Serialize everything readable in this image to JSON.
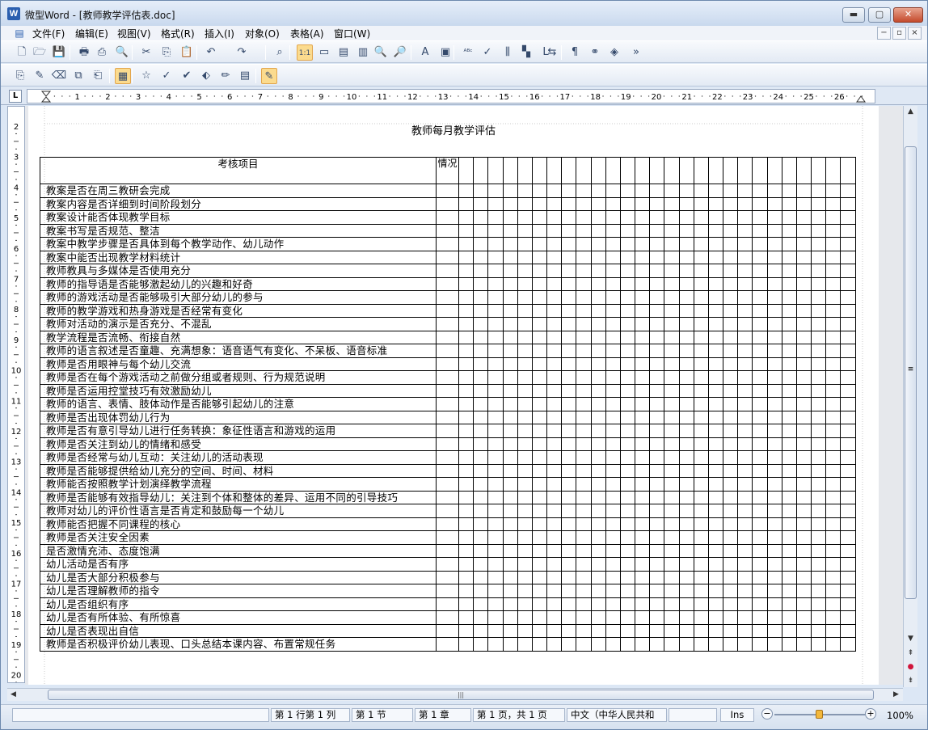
{
  "window": {
    "app_icon": "W",
    "title": "微型Word - [教师教学评估表.doc]",
    "minimize": "▬",
    "maximize": "▢",
    "close": "✕"
  },
  "menu": {
    "items": [
      "文件(F)",
      "编辑(E)",
      "视图(V)",
      "格式(R)",
      "插入(I)",
      "对象(O)",
      "表格(A)",
      "窗口(W)"
    ],
    "mdi_minimize": "−",
    "mdi_restore": "▫",
    "mdi_close": "×"
  },
  "toolbar1": {
    "icons": [
      "new-document-icon",
      "open-folder-icon",
      "save-icon",
      "print-icon",
      "pdf-export-icon",
      "print-preview-icon",
      "cut-icon",
      "copy-icon",
      "paste-icon",
      "undo-icon",
      "redo-icon",
      "find-icon",
      "actual-size-icon",
      "page-width-icon",
      "single-page-icon",
      "two-pages-icon",
      "zoom-in-icon",
      "zoom-out-icon",
      "font-color-icon",
      "text-box-icon",
      "spell-check-icon",
      "auto-correct-icon",
      "columns-icon",
      "shadow-icon",
      "border-icon",
      "merge-icon",
      "paragraph-marks-icon",
      "link-icon",
      "object-icon"
    ],
    "glyphs": [
      "🗋",
      "🗁",
      "💾",
      "🖶",
      "⎙",
      "🔍",
      "✂",
      "⎘",
      "📋",
      "↶",
      "↷",
      "⌕",
      "1:1",
      "▭",
      "▤",
      "▥",
      "🔍",
      "🔎",
      "A",
      "▣",
      "ᴬᴮᶜ",
      "✓",
      "⫼",
      "▚",
      "L",
      "⇆",
      "¶",
      "⚭",
      "◈"
    ],
    "more": "»"
  },
  "toolbar2": {
    "icons": [
      "insert-field-icon",
      "edit-field-icon",
      "delete-field-icon",
      "copy-field-icon",
      "paste-field-icon",
      "form-icon",
      "star-icon",
      "check-icon",
      "highlight-icon",
      "tag-icon",
      "pencil-icon",
      "notes-icon",
      "review-icon"
    ],
    "glyphs": [
      "⎘",
      "✎",
      "⌫",
      "⧉",
      "⎗",
      "▦",
      "☆",
      "✓",
      "✔",
      "⬖",
      "✏",
      "▤",
      "✎"
    ]
  },
  "ruler": {
    "tab_label": "L",
    "h_ticks": [
      "1",
      "2",
      "3",
      "4",
      "5",
      "6",
      "7",
      "8",
      "9",
      "10",
      "11",
      "12",
      "13",
      "14",
      "15",
      "16",
      "17",
      "18",
      "19",
      "20",
      "21",
      "22",
      "23",
      "24",
      "25",
      "26"
    ],
    "v_ticks": [
      "2",
      "3",
      "4",
      "5",
      "6",
      "7",
      "8",
      "9",
      "10",
      "11",
      "12",
      "13",
      "14",
      "15",
      "16",
      "17",
      "18",
      "19",
      "20"
    ]
  },
  "document": {
    "title": "教师每月教学评估",
    "header_item": "考核项目",
    "header_status": "情况",
    "rows": [
      "教案是否在周三教研会完成",
      "教案内容是否详细到时间阶段划分",
      "教案设计能否体现教学目标",
      "教案书写是否规范、整洁",
      "教案中教学步骤是否具体到每个教学动作、幼儿动作",
      "教案中能否出现教学材料统计",
      "教师教具与多媒体是否使用充分",
      "教师的指导语是否能够激起幼儿的兴趣和好奇",
      "教师的游戏活动是否能够吸引大部分幼儿的参与",
      "教师的教学游戏和热身游戏是否经常有变化",
      "教师对活动的演示是否充分、不混乱",
      "教学流程是否流畅、衔接自然",
      "教师的语言叙述是否童趣、充满想象：语音语气有变化、不呆板、语音标准",
      "教师是否用眼神与每个幼儿交流",
      "教师是否在每个游戏活动之前做分组或者规则、行为规范说明",
      "教师是否运用控堂技巧有效激励幼儿",
      "教师的语言、表情、肢体动作是否能够引起幼儿的注意",
      "教师是否出现体罚幼儿行为",
      "教师是否有意引导幼儿进行任务转换：象征性语言和游戏的运用",
      "教师是否关注到幼儿的情绪和感受",
      "教师是否经常与幼儿互动：关注幼儿的活动表现",
      "教师是否能够提供给幼儿充分的空间、时间、材料",
      "教师能否按照教学计划演绎教学流程",
      "教师是否能够有效指导幼儿：关注到个体和整体的差异、运用不同的引导技巧",
      "教师对幼儿的评价性语言是否肯定和鼓励每一个幼儿",
      "教师能否把握不同课程的核心",
      "教师是否关注安全因素",
      "是否激情充沛、态度饱满",
      "幼儿活动是否有序",
      "幼儿是否大部分积极参与",
      "幼儿是否理解教师的指令",
      "幼儿是否组织有序",
      "幼儿是否有所体验、有所惊喜",
      "幼儿是否表现出自信",
      "教师是否积极评价幼儿表现、口头总结本课内容、布置常规任务"
    ]
  },
  "scrollbars": {
    "up": "▲",
    "down": "▼",
    "left": "◀",
    "right": "▶",
    "prev_page": "⇞",
    "select_browse": "●",
    "next_page": "⇟",
    "h_grip": "|||",
    "v_grip": "≡"
  },
  "status": {
    "position": "第 1 行第 1 列",
    "section": "第 1 节",
    "chapter": "第 1 章",
    "page": "第 1 页，共 1 页",
    "language": "中文（中华人民共和",
    "blank": "",
    "mode": "Ins",
    "zoom_minus": "−",
    "zoom_plus": "+",
    "zoom": "100%",
    "zoom_fraction": 0.5
  }
}
